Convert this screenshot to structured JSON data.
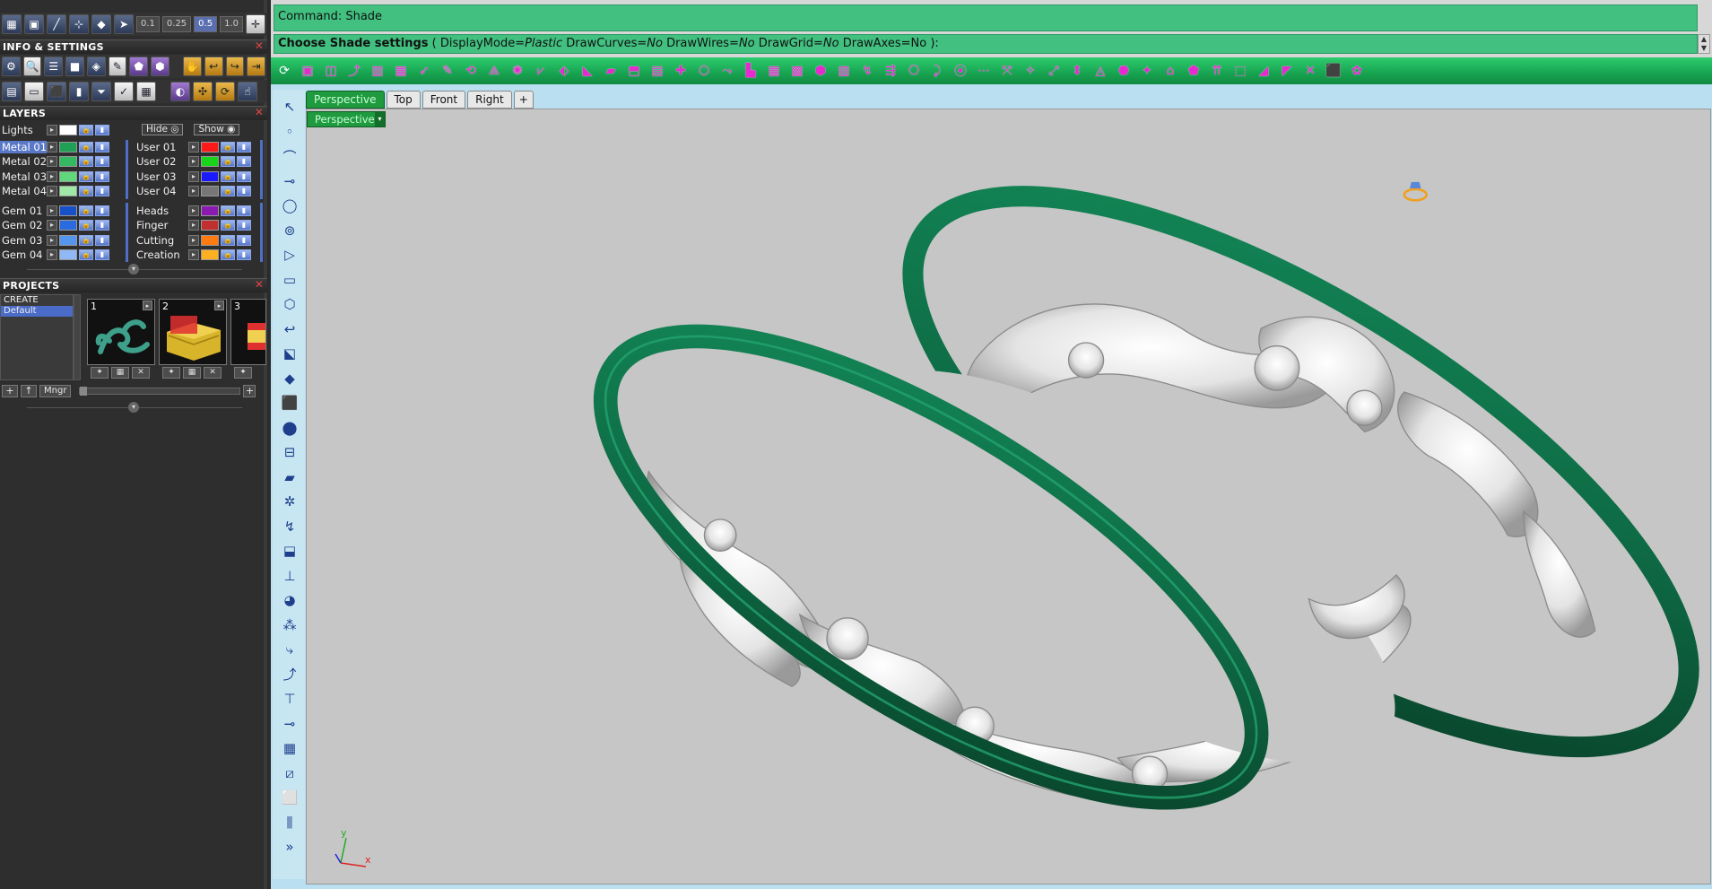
{
  "command": {
    "line1": "Command: Shade",
    "prompt_bold": "Choose Shade settings",
    "prompt_rest_1": " ( ",
    "opt1_label": "DisplayMode=",
    "opt1_value": "Plastic",
    "opt2_label": "  DrawCurves=",
    "opt2_value": "No",
    "opt3_label": "  DrawWires=",
    "opt3_value": "No",
    "opt4_label": "  DrawGrid=",
    "opt4_value": "No",
    "opt5_label": "  DrawAxes=No ):"
  },
  "zoom_values": [
    "0.1",
    "0.25",
    "0.5",
    "1.0"
  ],
  "panels": {
    "info": "INFO & SETTINGS",
    "layers": "LAYERS",
    "projects": "PROJECTS"
  },
  "layers": {
    "lights_label": "Lights",
    "hide_label": "Hide",
    "show_label": "Show",
    "left": [
      {
        "name": "Metal 01",
        "color": "#1fa055"
      },
      {
        "name": "Metal 02",
        "color": "#34b862"
      },
      {
        "name": "Metal 03",
        "color": "#5fd77a"
      },
      {
        "name": "Metal 04",
        "color": "#9fe8a8"
      },
      {
        "name": "Gem 01",
        "color": "#1850c8"
      },
      {
        "name": "Gem 02",
        "color": "#2a6be0"
      },
      {
        "name": "Gem 03",
        "color": "#5595f0"
      },
      {
        "name": "Gem 04",
        "color": "#8fb8f5"
      }
    ],
    "right": [
      {
        "name": "User 01",
        "color": "#ff1a1a"
      },
      {
        "name": "User 02",
        "color": "#1ad41a"
      },
      {
        "name": "User 03",
        "color": "#1a1aff"
      },
      {
        "name": "User 04",
        "color": "#777777"
      },
      {
        "name": "Heads",
        "color": "#8a1ab0"
      },
      {
        "name": "Finger",
        "color": "#c03030"
      },
      {
        "name": "Cutting",
        "color": "#ff7a10"
      },
      {
        "name": "Creation",
        "color": "#ffb020"
      }
    ]
  },
  "projects": {
    "items": [
      "CREATE",
      "Default"
    ],
    "thumbs": [
      "1",
      "2",
      "3"
    ],
    "mngr_label": "Mngr"
  },
  "viewport": {
    "tabs": [
      "Perspective",
      "Top",
      "Front",
      "Right",
      "+"
    ],
    "current_view": "Perspective",
    "axis_y": "y",
    "axis_x": "x"
  },
  "colors": {
    "command_bg": "#41c080",
    "band_green": "#0e6b45",
    "filigree": "#e4e4e4",
    "viewport_bg": "#c6c6c6"
  }
}
